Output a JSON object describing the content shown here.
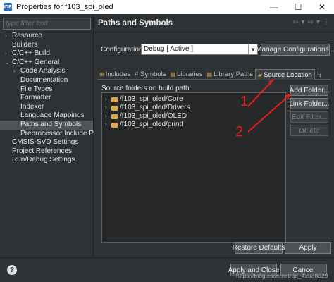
{
  "window": {
    "title": "Properties for f103_spi_oled",
    "minimize": "—",
    "maximize": "☐",
    "close": "✕",
    "icon": "eclipse-app-icon",
    "icon_text": "IDE"
  },
  "left_pane": {
    "filter_placeholder": "type filter text",
    "tree": [
      {
        "label": "Resource",
        "level": 0,
        "arrow": "›"
      },
      {
        "label": "Builders",
        "level": 0,
        "arrow": ""
      },
      {
        "label": "C/C++ Build",
        "level": 0,
        "arrow": "›"
      },
      {
        "label": "C/C++ General",
        "level": 0,
        "arrow": "⌄"
      },
      {
        "label": "Code Analysis",
        "level": 1,
        "arrow": "›"
      },
      {
        "label": "Documentation",
        "level": 1,
        "arrow": ""
      },
      {
        "label": "File Types",
        "level": 1,
        "arrow": ""
      },
      {
        "label": "Formatter",
        "level": 1,
        "arrow": ""
      },
      {
        "label": "Indexer",
        "level": 1,
        "arrow": ""
      },
      {
        "label": "Language Mappings",
        "level": 1,
        "arrow": ""
      },
      {
        "label": "Paths and Symbols",
        "level": 1,
        "arrow": "",
        "selected": true
      },
      {
        "label": "Preprocessor Include Paths",
        "level": 1,
        "arrow": ""
      },
      {
        "label": "CMSIS-SVD Settings",
        "level": 0,
        "arrow": ""
      },
      {
        "label": "Project References",
        "level": 0,
        "arrow": ""
      },
      {
        "label": "Run/Debug Settings",
        "level": 0,
        "arrow": ""
      }
    ]
  },
  "page": {
    "title": "Paths and Symbols",
    "nav_back": "⇦",
    "nav_back_menu": "▾",
    "nav_forward": "⇨",
    "nav_forward_menu": "▾",
    "nav_menu": "⋮",
    "configuration_label": "Configuration:",
    "configuration_value": "Debug  [ Active ]",
    "manage_button": "Manage Configurations...",
    "tabs": [
      {
        "label": "Includes",
        "icon": "include-icon",
        "active": false
      },
      {
        "label": "# Symbols",
        "icon": "symbols-icon",
        "active": false
      },
      {
        "label": "Libraries",
        "icon": "library-icon",
        "active": false
      },
      {
        "label": "Library Paths",
        "icon": "library-path-icon",
        "active": false
      },
      {
        "label": "Source Location",
        "icon": "source-folder-icon",
        "active": true
      },
      {
        "label": "¹₁",
        "icon": "more-tabs-icon",
        "active": false
      }
    ],
    "folders_label": "Source folders on build path:",
    "folders": [
      "/f103_spi_oled/Core",
      "/f103_spi_oled/Drivers",
      "/f103_spi_oled/OLED",
      "/f103_spi_oled/printf"
    ],
    "side_buttons": {
      "add_folder": "Add Folder...",
      "link_folder": "Link Folder...",
      "edit_filter": "Edit Filter...",
      "delete": "Delete"
    },
    "restore_defaults": "Restore Defaults",
    "apply": "Apply"
  },
  "footer": {
    "help": "?",
    "apply_close": "Apply and Close",
    "cancel": "Cancel"
  },
  "annotations": {
    "marker_1": "1",
    "marker_2": "2",
    "color": "#e81e1e"
  },
  "watermark": "https://blog.csdn.net/qq_42038029"
}
